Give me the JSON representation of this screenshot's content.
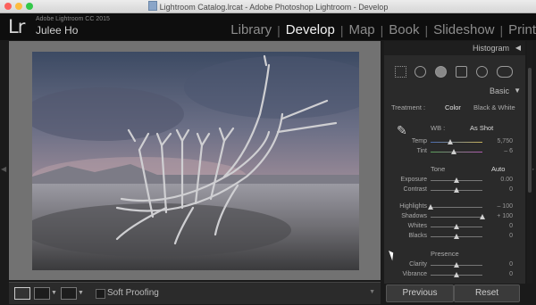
{
  "window": {
    "title": "Lightroom Catalog.lrcat - Adobe Photoshop Lightroom - Develop"
  },
  "identity": {
    "logo": "Lr",
    "version": "Adobe Lightroom CC 2015",
    "user": "Julee Ho"
  },
  "modules": [
    {
      "label": "Library",
      "active": false
    },
    {
      "label": "Develop",
      "active": true
    },
    {
      "label": "Map",
      "active": false
    },
    {
      "label": "Book",
      "active": false
    },
    {
      "label": "Slideshow",
      "active": false
    },
    {
      "label": "Print",
      "active": false
    }
  ],
  "toolbar": {
    "soft_proofing": "Soft Proofing"
  },
  "panel": {
    "histogram_title": "Histogram",
    "basic_title": "Basic",
    "treatment_label": "Treatment :",
    "treatment_color": "Color",
    "treatment_bw": "Black & White",
    "wb_label": "WB :",
    "wb_value": "As Shot",
    "sliders_wb": [
      {
        "label": "Temp",
        "value": "5,750",
        "pos": 0.38
      },
      {
        "label": "Tint",
        "value": "– 6",
        "pos": 0.45
      }
    ],
    "tone_label": "Tone",
    "auto_label": "Auto",
    "sliders_tone": [
      {
        "label": "Exposure",
        "value": "0.00",
        "pos": 0.5
      },
      {
        "label": "Contrast",
        "value": "0",
        "pos": 0.5
      }
    ],
    "sliders_tone2": [
      {
        "label": "Highlights",
        "value": "– 100",
        "pos": 0.0
      },
      {
        "label": "Shadows",
        "value": "+ 100",
        "pos": 1.0
      },
      {
        "label": "Whites",
        "value": "0",
        "pos": 0.5
      },
      {
        "label": "Blacks",
        "value": "0",
        "pos": 0.5
      }
    ],
    "presence_label": "Presence",
    "sliders_presence": [
      {
        "label": "Clarity",
        "value": "0",
        "pos": 0.5
      },
      {
        "label": "Vibrance",
        "value": "0",
        "pos": 0.5
      }
    ],
    "previous_button": "Previous",
    "reset_button": "Reset"
  }
}
